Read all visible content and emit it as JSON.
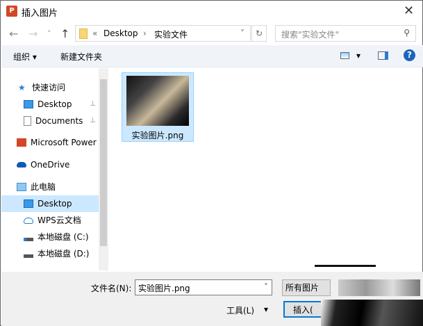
{
  "window": {
    "title": "插入图片",
    "app_icon": "P",
    "close": "✕"
  },
  "address": {
    "back": "←",
    "forward": "→",
    "recent": "˅",
    "up": "↑",
    "prefix": "«",
    "crumbs": [
      "Desktop",
      "实验文件"
    ],
    "sep": "›",
    "dropdown": "˅",
    "refresh": "↻"
  },
  "search": {
    "placeholder": "搜索\"实验文件\"",
    "icon": "⚲"
  },
  "toolbar": {
    "organize": "组织 ▾",
    "new_folder": "新建文件夹",
    "view_arrow": "▾",
    "help": "?"
  },
  "sidebar": {
    "items": [
      {
        "label": "快速访问",
        "icon": "star-icon"
      },
      {
        "label": "Desktop",
        "icon": "desktop-icon"
      },
      {
        "label": "Documents",
        "icon": "document-icon"
      },
      {
        "label": "Microsoft Power",
        "icon": "powerpoint-icon"
      },
      {
        "label": "OneDrive",
        "icon": "cloud-icon"
      },
      {
        "label": "此电脑",
        "icon": "computer-icon"
      },
      {
        "label": "Desktop",
        "icon": "desktop-icon"
      },
      {
        "label": "WPS云文档",
        "icon": "cloud-icon"
      },
      {
        "label": "本地磁盘 (C:)",
        "icon": "drive-icon"
      },
      {
        "label": "本地磁盘 (D:)",
        "icon": "drive-icon"
      }
    ],
    "pin": "📌"
  },
  "files": [
    {
      "name": "实验图片.png"
    }
  ],
  "bottom": {
    "filename_label": "文件名(N):",
    "filename_value": "实验图片.png",
    "filetype": "所有图片",
    "tools": "工具(L)",
    "tools_arrow": "▾",
    "insert": "插入(",
    "dropdown": "˅"
  }
}
